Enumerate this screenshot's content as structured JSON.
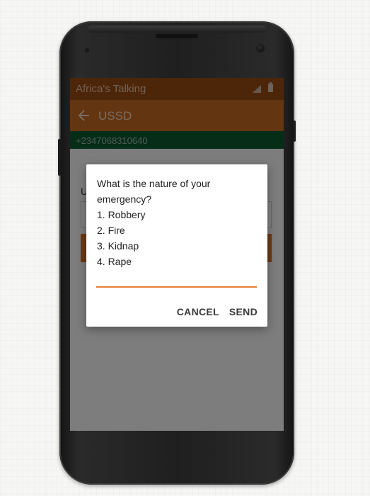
{
  "status_bar": {
    "title": "Africa's Talking"
  },
  "app_bar": {
    "title": "USSD",
    "back_icon": "arrow-back-icon"
  },
  "number_bar": {
    "phone_number": "+2347068310640"
  },
  "form": {
    "label_partial": "U"
  },
  "dialog": {
    "message_lines": [
      "What is the nature of your",
      "emergency?",
      "1. Robbery",
      "2. Fire",
      "3. Kidnap",
      "4. Rape"
    ],
    "input_value": "",
    "cancel_label": "CANCEL",
    "send_label": "SEND"
  },
  "colors": {
    "status_bar": "#9b4d13",
    "app_bar": "#c66b23",
    "number_bar": "#0d5a2e",
    "accent": "#e5803a",
    "dialog_text": "#212121"
  }
}
